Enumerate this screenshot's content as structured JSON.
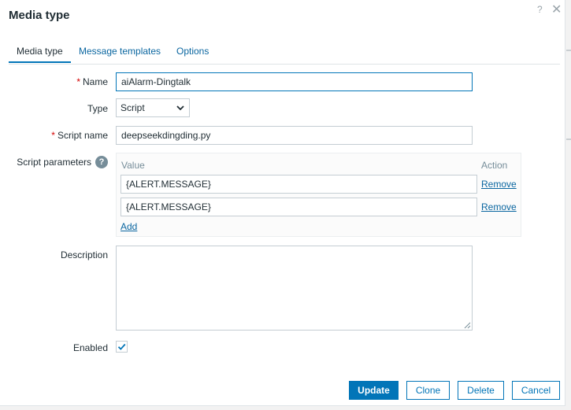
{
  "dialog": {
    "title": "Media type",
    "help_glyph": "?",
    "close_glyph": "✕"
  },
  "tabs": [
    {
      "label": "Media type",
      "active": true
    },
    {
      "label": "Message templates",
      "active": false
    },
    {
      "label": "Options",
      "active": false
    }
  ],
  "form": {
    "name": {
      "label": "Name",
      "required": "*",
      "value": "aiAlarm-Dingtalk"
    },
    "type": {
      "label": "Type",
      "value": "Script"
    },
    "script_name": {
      "label": "Script name",
      "required": "*",
      "value": "deepseekdingding.py"
    },
    "script_parameters": {
      "label": "Script parameters",
      "help_glyph": "?",
      "col_value": "Value",
      "col_action": "Action",
      "rows": [
        {
          "value": "{ALERT.MESSAGE}",
          "action": "Remove"
        },
        {
          "value": "{ALERT.MESSAGE}",
          "action": "Remove"
        }
      ],
      "add_label": "Add"
    },
    "description": {
      "label": "Description",
      "value": ""
    },
    "enabled": {
      "label": "Enabled",
      "checked": true
    }
  },
  "buttons": {
    "update": "Update",
    "clone": "Clone",
    "delete": "Delete",
    "cancel": "Cancel"
  },
  "colors": {
    "accent": "#0275b8",
    "link": "#0a66a0",
    "required": "#d40000"
  }
}
